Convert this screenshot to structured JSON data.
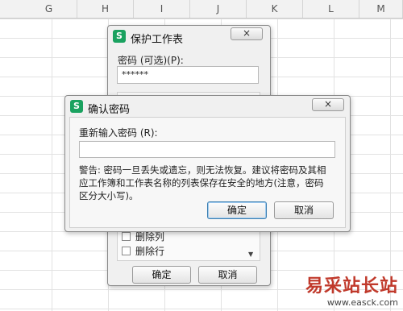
{
  "spreadsheet": {
    "columns": [
      "G",
      "H",
      "I",
      "J",
      "K",
      "L",
      "M"
    ]
  },
  "protect_dialog": {
    "title": "保护工作表",
    "close_label": "×",
    "password_label": "密码 (可选)(P):",
    "password_value": "******",
    "options": [
      {
        "label": "删除列",
        "checked": false
      },
      {
        "label": "删除行",
        "checked": false
      }
    ],
    "ok_label": "确定",
    "cancel_label": "取消"
  },
  "confirm_dialog": {
    "title": "确认密码",
    "close_label": "×",
    "reenter_label": "重新输入密码 (R):",
    "reenter_value": "",
    "warning_line1": "警告: 密码一旦丢失或遗忘，则无法恢复。建议将密码及其相",
    "warning_line2": "应工作簿和工作表名称的列表保存在安全的地方(注意，密码",
    "warning_line3": "区分大小写)。",
    "ok_label": "确定",
    "cancel_label": "取消"
  },
  "watermark": {
    "line1": "易采站长站",
    "line2": "www.easck.com"
  },
  "colors": {
    "app_icon": "#1aa260",
    "watermark": "#c0392b"
  }
}
